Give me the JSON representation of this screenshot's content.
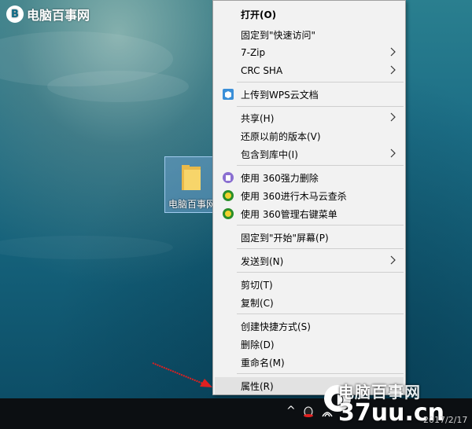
{
  "watermark_top": {
    "logo": "B",
    "text": "电脑百事网"
  },
  "desktop_icon": {
    "label": "电脑百事网",
    "icon": "folder-icon"
  },
  "menu": {
    "items": [
      {
        "label": "打开(O)",
        "bold": true
      },
      {
        "label": "固定到\"快速访问\""
      },
      {
        "label": "7-Zip",
        "submenu": true
      },
      {
        "label": "CRC SHA",
        "submenu": true
      },
      {
        "label": "上传到WPS云文档",
        "icon": "wps-cloud-icon"
      },
      {
        "label": "共享(H)",
        "submenu": true
      },
      {
        "label": "还原以前的版本(V)"
      },
      {
        "label": "包含到库中(I)",
        "submenu": true
      },
      {
        "label": "使用 360强力删除",
        "icon": "360-delete-icon"
      },
      {
        "label": "使用 360进行木马云查杀",
        "icon": "360-scan-icon"
      },
      {
        "label": "使用 360管理右键菜单",
        "icon": "360-manage-icon"
      },
      {
        "label": "固定到\"开始\"屏幕(P)"
      },
      {
        "label": "发送到(N)",
        "submenu": true
      },
      {
        "label": "剪切(T)"
      },
      {
        "label": "复制(C)"
      },
      {
        "label": "创建快捷方式(S)"
      },
      {
        "label": "删除(D)"
      },
      {
        "label": "重命名(M)"
      },
      {
        "label": "属性(R)",
        "highlighted": true
      }
    ]
  },
  "taskbar": {
    "tray_chevron": "^",
    "clock_partial": "2017/2/17"
  },
  "watermark_bottom": {
    "line1": "电脑百事网",
    "line2": "37uu.cn"
  },
  "colors": {
    "menu_bg": "#f2f2f2",
    "highlight": "#e2e2e2",
    "arrow": "#e02020"
  }
}
